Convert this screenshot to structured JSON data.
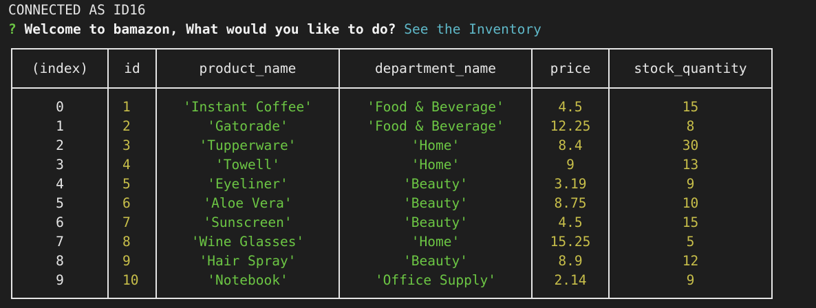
{
  "terminal": {
    "connected_line": "CONNECTED AS ID16",
    "prompt_mark": "?",
    "prompt_text": "Welcome to bamazon, What would you like to do?",
    "prompt_answer": "See the Inventory"
  },
  "table": {
    "headers": [
      "(index)",
      "id",
      "product_name",
      "department_name",
      "price",
      "stock_quantity"
    ],
    "rows": [
      {
        "index": "0",
        "id": "1",
        "product_name": "'Instant Coffee'",
        "department_name": "'Food & Beverage'",
        "price": "4.5",
        "stock_quantity": "15"
      },
      {
        "index": "1",
        "id": "2",
        "product_name": "'Gatorade'",
        "department_name": "'Food & Beverage'",
        "price": "12.25",
        "stock_quantity": "8"
      },
      {
        "index": "2",
        "id": "3",
        "product_name": "'Tupperware'",
        "department_name": "'Home'",
        "price": "8.4",
        "stock_quantity": "30"
      },
      {
        "index": "3",
        "id": "4",
        "product_name": "'Towell'",
        "department_name": "'Home'",
        "price": "9",
        "stock_quantity": "13"
      },
      {
        "index": "4",
        "id": "5",
        "product_name": "'Eyeliner'",
        "department_name": "'Beauty'",
        "price": "3.19",
        "stock_quantity": "9"
      },
      {
        "index": "5",
        "id": "6",
        "product_name": "'Aloe Vera'",
        "department_name": "'Beauty'",
        "price": "8.75",
        "stock_quantity": "10"
      },
      {
        "index": "6",
        "id": "7",
        "product_name": "'Sunscreen'",
        "department_name": "'Beauty'",
        "price": "4.5",
        "stock_quantity": "15"
      },
      {
        "index": "7",
        "id": "8",
        "product_name": "'Wine Glasses'",
        "department_name": "'Home'",
        "price": "15.25",
        "stock_quantity": "5"
      },
      {
        "index": "8",
        "id": "9",
        "product_name": "'Hair Spray'",
        "department_name": "'Beauty'",
        "price": "8.9",
        "stock_quantity": "12"
      },
      {
        "index": "9",
        "id": "10",
        "product_name": "'Notebook'",
        "department_name": "'Office Supply'",
        "price": "2.14",
        "stock_quantity": "9"
      }
    ]
  },
  "colors": {
    "background": "#1e1e1e",
    "text": "#e6e6e6",
    "prompt_mark": "#6cc644",
    "answer": "#5fb8c8",
    "string_value": "#6cc644",
    "number_value": "#c8bf4a"
  }
}
